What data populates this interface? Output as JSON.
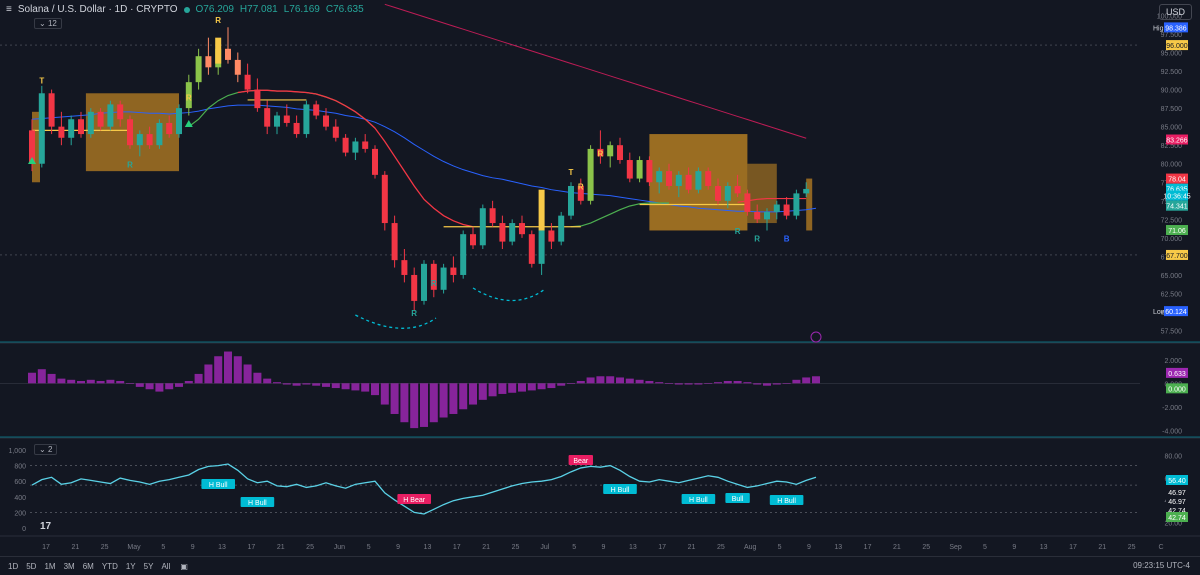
{
  "header": {
    "symbol": "Solana / U.S. Dollar · 1D · CRYPTO",
    "open": "O76.209",
    "high": "H77.081",
    "low": "L76.169",
    "close": "C76.635",
    "indicator_count": "12"
  },
  "currency": "USD",
  "osc_pill": "2",
  "price_axis": {
    "ticks": [
      "100.000",
      "97.500",
      "95.000",
      "92.500",
      "90.000",
      "87.500",
      "85.000",
      "82.500",
      "80.000",
      "77.500",
      "75.000",
      "72.500",
      "70.000",
      "67.500",
      "65.000",
      "62.500",
      "60.000",
      "57.500"
    ],
    "ylim": [
      56.5,
      101
    ]
  },
  "price_tags": [
    {
      "label": "High",
      "value": "98.386",
      "price": 98.386,
      "color": "#2962ff",
      "with_label": true
    },
    {
      "label": "",
      "value": "96.000",
      "price": 96.0,
      "color": "#f7c948"
    },
    {
      "label": "",
      "value": "83.266",
      "price": 83.266,
      "color": "#e91e63"
    },
    {
      "label": "",
      "value": "78.04",
      "price": 78.0,
      "color": "#f23645"
    },
    {
      "label": "",
      "value": "76.635",
      "price": 76.635,
      "color": "#00bcd4"
    },
    {
      "label": "",
      "value": "10:36:45",
      "price": 75.7,
      "color": "#00bcd4"
    },
    {
      "label": "",
      "value": "74.341",
      "price": 74.341,
      "color": "#26a69a"
    },
    {
      "label": "",
      "value": "71.06",
      "price": 71.06,
      "color": "#4caf50"
    },
    {
      "label": "",
      "value": "67.700",
      "price": 67.7,
      "color": "#f7c948"
    },
    {
      "label": "Low",
      "value": "60.124",
      "price": 60.124,
      "color": "#2962ff",
      "with_label": true
    }
  ],
  "macd_axis": {
    "ticks": [
      "2.000",
      "0.000",
      "-2.000",
      "-4.000"
    ],
    "ylim": [
      -4.3,
      3.0
    ],
    "tags": [
      {
        "value": "0.633",
        "color": "#9c27b0",
        "level": 0.633
      },
      {
        "value": "0.000",
        "color": "#4caf50",
        "level": 0.0
      }
    ]
  },
  "osc_axis": {
    "left_ticks": [
      "1,000",
      "800",
      "600",
      "400",
      "200",
      "0"
    ],
    "right_ticks": [
      "80.00",
      "60.00",
      "40.00",
      "20.00"
    ],
    "tags": [
      {
        "value": "56.40",
        "color": "#00bcd4"
      },
      {
        "value": "46.97",
        "color": "#131722"
      },
      {
        "value": "46.97",
        "color": "#131722"
      },
      {
        "value": "42.74",
        "color": "#131722"
      },
      {
        "value": "42.74",
        "color": "#4caf50"
      }
    ]
  },
  "time_axis": [
    "17",
    "21",
    "25",
    "May",
    "5",
    "9",
    "13",
    "17",
    "21",
    "25",
    "Jun",
    "5",
    "9",
    "13",
    "17",
    "21",
    "25",
    "Jul",
    "5",
    "9",
    "13",
    "17",
    "21",
    "25",
    "Aug",
    "5",
    "9",
    "13",
    "17",
    "21",
    "25",
    "Sep",
    "5",
    "9",
    "13",
    "17",
    "21",
    "25",
    "C"
  ],
  "bottom_bar": {
    "ranges": [
      "1D",
      "5D",
      "1M",
      "3M",
      "6M",
      "YTD",
      "1Y",
      "5Y",
      "All"
    ],
    "clock": "09:23:15 UTC-4"
  },
  "chart_data": {
    "type": "candlestick",
    "title": "Solana / U.S. Dollar · 1D · CRYPTO",
    "ylim": [
      56.5,
      101
    ],
    "candles": [
      [
        84.5,
        86.0,
        79.0,
        80.0
      ],
      [
        80.0,
        90.5,
        79.5,
        89.5
      ],
      [
        89.5,
        90.0,
        84.0,
        85.0
      ],
      [
        85.0,
        87.0,
        82.5,
        83.5
      ],
      [
        83.5,
        86.5,
        82.5,
        86.0
      ],
      [
        86.0,
        87.0,
        83.5,
        84.0
      ],
      [
        84.0,
        87.5,
        83.5,
        87.0
      ],
      [
        87.0,
        87.5,
        84.5,
        85.0
      ],
      [
        85.0,
        88.5,
        84.5,
        88.0
      ],
      [
        88.0,
        88.5,
        85.0,
        86.0
      ],
      [
        86.0,
        86.5,
        82.0,
        82.5
      ],
      [
        82.5,
        84.5,
        81.0,
        84.0
      ],
      [
        84.0,
        85.0,
        82.0,
        82.5
      ],
      [
        82.5,
        86.0,
        82.0,
        85.5
      ],
      [
        85.5,
        86.5,
        83.5,
        84.0
      ],
      [
        84.0,
        88.0,
        83.5,
        87.5
      ],
      [
        87.5,
        92.0,
        86.5,
        91.0
      ],
      [
        91.0,
        95.5,
        90.0,
        94.5
      ],
      [
        94.5,
        97.0,
        92.0,
        93.0
      ],
      [
        93.0,
        96.0,
        92.0,
        95.5
      ],
      [
        95.5,
        98.4,
        93.5,
        94.0
      ],
      [
        94.0,
        95.0,
        91.0,
        92.0
      ],
      [
        92.0,
        93.5,
        89.5,
        90.0
      ],
      [
        90.0,
        91.5,
        87.0,
        87.5
      ],
      [
        87.5,
        88.5,
        84.0,
        85.0
      ],
      [
        85.0,
        87.0,
        84.0,
        86.5
      ],
      [
        86.5,
        88.0,
        85.0,
        85.5
      ],
      [
        85.5,
        86.5,
        83.5,
        84.0
      ],
      [
        84.0,
        88.5,
        83.5,
        88.0
      ],
      [
        88.0,
        88.5,
        86.0,
        86.5
      ],
      [
        86.5,
        87.5,
        84.5,
        85.0
      ],
      [
        85.0,
        86.0,
        83.0,
        83.5
      ],
      [
        83.5,
        84.0,
        81.0,
        81.5
      ],
      [
        81.5,
        83.5,
        80.5,
        83.0
      ],
      [
        83.0,
        84.0,
        81.5,
        82.0
      ],
      [
        82.0,
        82.5,
        78.0,
        78.5
      ],
      [
        78.5,
        79.0,
        71.0,
        72.0
      ],
      [
        72.0,
        73.0,
        66.0,
        67.0
      ],
      [
        67.0,
        68.5,
        64.0,
        65.0
      ],
      [
        65.0,
        66.0,
        60.1,
        61.5
      ],
      [
        61.5,
        67.0,
        61.0,
        66.5
      ],
      [
        66.5,
        67.0,
        62.0,
        63.0
      ],
      [
        63.0,
        66.5,
        62.5,
        66.0
      ],
      [
        66.0,
        67.5,
        64.0,
        65.0
      ],
      [
        65.0,
        71.0,
        64.5,
        70.5
      ],
      [
        70.5,
        71.5,
        68.5,
        69.0
      ],
      [
        69.0,
        74.5,
        68.5,
        74.0
      ],
      [
        74.0,
        75.0,
        71.5,
        72.0
      ],
      [
        72.0,
        73.0,
        68.5,
        69.5
      ],
      [
        69.5,
        72.5,
        69.0,
        72.0
      ],
      [
        72.0,
        73.0,
        70.0,
        70.5
      ],
      [
        70.5,
        71.0,
        66.0,
        66.5
      ],
      [
        66.5,
        71.5,
        65.0,
        71.0
      ],
      [
        71.0,
        72.0,
        68.5,
        69.5
      ],
      [
        69.5,
        73.5,
        69.0,
        73.0
      ],
      [
        73.0,
        77.5,
        72.5,
        77.0
      ],
      [
        77.0,
        78.0,
        74.5,
        75.0
      ],
      [
        75.0,
        82.5,
        74.5,
        82.0
      ],
      [
        82.0,
        84.5,
        80.0,
        81.0
      ],
      [
        81.0,
        83.0,
        79.5,
        82.5
      ],
      [
        82.5,
        83.5,
        80.0,
        80.5
      ],
      [
        80.5,
        81.5,
        77.5,
        78.0
      ],
      [
        78.0,
        81.0,
        77.5,
        80.5
      ],
      [
        80.5,
        81.0,
        77.0,
        77.5
      ],
      [
        77.5,
        79.5,
        76.0,
        79.0
      ],
      [
        79.0,
        80.0,
        76.5,
        77.0
      ],
      [
        77.0,
        79.0,
        75.5,
        78.5
      ],
      [
        78.5,
        79.5,
        76.0,
        76.5
      ],
      [
        76.5,
        79.5,
        76.0,
        79.0
      ],
      [
        79.0,
        79.5,
        76.5,
        77.0
      ],
      [
        77.0,
        78.0,
        74.5,
        75.0
      ],
      [
        75.0,
        77.5,
        74.0,
        77.0
      ],
      [
        77.0,
        78.5,
        75.5,
        76.0
      ],
      [
        76.0,
        76.5,
        73.0,
        73.5
      ],
      [
        73.5,
        74.5,
        72.0,
        72.5
      ],
      [
        72.5,
        74.0,
        71.0,
        73.5
      ],
      [
        73.5,
        75.0,
        72.5,
        74.5
      ],
      [
        74.5,
        75.5,
        72.5,
        73.0
      ],
      [
        73.0,
        76.5,
        72.5,
        76.0
      ],
      [
        76.0,
        77.5,
        75.5,
        76.6
      ]
    ],
    "macd_histogram": [
      0.9,
      1.2,
      0.8,
      0.4,
      0.3,
      0.2,
      0.3,
      0.2,
      0.3,
      0.2,
      0.0,
      -0.3,
      -0.5,
      -0.7,
      -0.5,
      -0.3,
      0.2,
      0.8,
      1.6,
      2.3,
      2.7,
      2.3,
      1.6,
      0.9,
      0.4,
      0.1,
      -0.1,
      -0.2,
      -0.1,
      -0.2,
      -0.3,
      -0.4,
      -0.5,
      -0.6,
      -0.7,
      -1.0,
      -1.8,
      -2.6,
      -3.3,
      -3.8,
      -3.7,
      -3.3,
      -2.9,
      -2.6,
      -2.2,
      -1.8,
      -1.4,
      -1.1,
      -0.9,
      -0.8,
      -0.7,
      -0.6,
      -0.5,
      -0.4,
      -0.2,
      0.0,
      0.2,
      0.5,
      0.6,
      0.6,
      0.5,
      0.4,
      0.3,
      0.2,
      0.1,
      0.0,
      -0.1,
      -0.1,
      -0.1,
      0.0,
      0.1,
      0.2,
      0.2,
      0.1,
      -0.1,
      -0.2,
      -0.1,
      0.0,
      0.3,
      0.5,
      0.6
    ],
    "oscillator": [
      550,
      620,
      650,
      560,
      580,
      630,
      610,
      590,
      570,
      640,
      610,
      590,
      560,
      600,
      620,
      650,
      680,
      750,
      790,
      800,
      820,
      740,
      630,
      580,
      600,
      540,
      530,
      560,
      520,
      540,
      580,
      540,
      510,
      560,
      580,
      600,
      450,
      360,
      280,
      200,
      180,
      240,
      300,
      350,
      380,
      400,
      420,
      460,
      500,
      540,
      570,
      590,
      600,
      620,
      660,
      720,
      770,
      790,
      780,
      800,
      740,
      660,
      600,
      590,
      620,
      600,
      580,
      610,
      640,
      670,
      650,
      600,
      560,
      520,
      540,
      570,
      600,
      590,
      560,
      610,
      650
    ],
    "annotations": [
      "T",
      "R",
      "R",
      "R",
      "R",
      "R",
      "R",
      "T",
      "R",
      "R",
      "R",
      "B"
    ],
    "oscillator_labels": [
      "H Bull",
      "H Bull",
      "H Bear",
      "Bear",
      "H Bull",
      "H Bull",
      "Bull",
      "H Bull"
    ]
  }
}
